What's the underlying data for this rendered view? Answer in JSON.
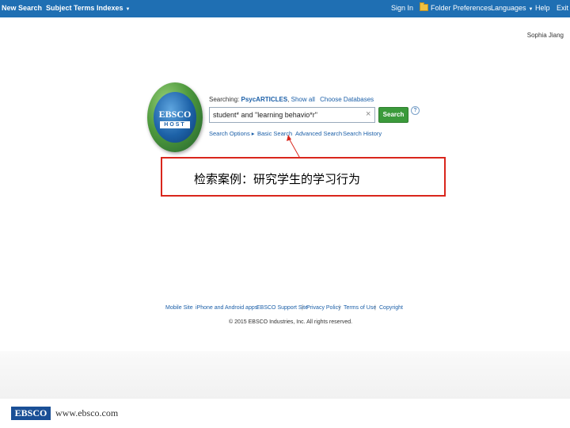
{
  "topbar": {
    "left": [
      "New Search",
      "Subject Terms",
      "Indexes"
    ],
    "right": [
      "Sign In",
      "Folder",
      "Preferences",
      "Languages",
      "Help",
      "Exit"
    ]
  },
  "user": {
    "name": "Sophia Jiang"
  },
  "logo": {
    "line1": "EBSCO",
    "line2": "HOST"
  },
  "search": {
    "searching_label": "Searching:",
    "database": "PsycARTICLES",
    "show_all": "Show all",
    "choose_databases": "Choose Databases",
    "query": "student* and \"learning behavio*r\"",
    "clear_symbol": "×",
    "button_label": "Search",
    "help_symbol": "?",
    "links": [
      "Search Options ▸",
      "Basic Search",
      "Advanced Search",
      "Search History"
    ]
  },
  "annotation": {
    "text": "检索案例：研究学生的学习行为",
    "color": "#d9261c"
  },
  "footer": {
    "links": [
      "Mobile Site",
      "iPhone and Android apps",
      "EBSCO Support Site",
      "Privacy Policy",
      "Terms of Use",
      "Copyright"
    ],
    "copyright": "© 2015 EBSCO Industries, Inc. All rights reserved."
  },
  "branding": {
    "logo_text": "EBSCO",
    "url": "www.ebsco.com"
  },
  "colors": {
    "topbar": "#1f6fb3",
    "search_button": "#3b9a3b",
    "link": "#1b5fa8"
  }
}
